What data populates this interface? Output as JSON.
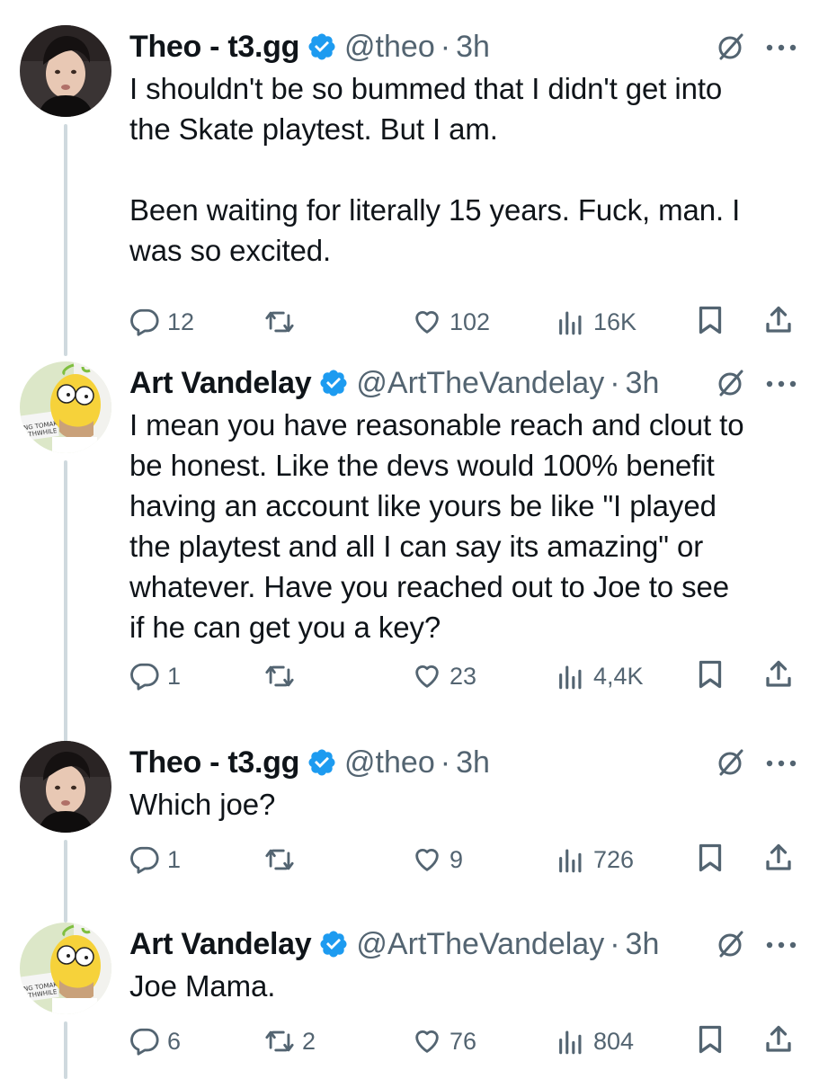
{
  "tweets": [
    {
      "author": "Theo - t3.gg",
      "handle": "@theo",
      "separator": "·",
      "time": "3h",
      "avatar": "theo-avatar",
      "text": "I shouldn't be so bummed that I didn't get into\nthe Skate playtest. But I am.\n\nBeen waiting for literally 15 years. Fuck, man. I\nwas so excited.",
      "replies": "12",
      "reposts": "",
      "likes": "102",
      "views": "16K"
    },
    {
      "author": "Art Vandelay",
      "handle": "@ArtTheVandelay",
      "separator": "·",
      "time": "3h",
      "avatar": "homer-avatar",
      "text": "I mean you have reasonable reach and clout to\nbe honest. Like the devs would 100% benefit\nhaving an account like yours be like \"I played\nthe playtest and all I can say its amazing\" or\nwhatever. Have you reached out to Joe to see\nif he can get you a key?",
      "replies": "1",
      "reposts": "",
      "likes": "23",
      "views": "4,4K"
    },
    {
      "author": "Theo - t3.gg",
      "handle": "@theo",
      "separator": "·",
      "time": "3h",
      "avatar": "theo-avatar",
      "text": "Which joe?",
      "replies": "1",
      "reposts": "",
      "likes": "9",
      "views": "726"
    },
    {
      "author": "Art Vandelay",
      "handle": "@ArtTheVandelay",
      "separator": "·",
      "time": "3h",
      "avatar": "homer-avatar",
      "text": "Joe Mama.",
      "replies": "6",
      "reposts": "2",
      "likes": "76",
      "views": "804"
    }
  ],
  "colors": {
    "verified": "#1d9bf0",
    "secondary_text": "#536471",
    "thread_line": "#cfd9de",
    "primary_text": "#0f1419"
  },
  "icons": [
    "verified-badge-icon",
    "grok-icon",
    "more-icon",
    "reply-icon",
    "repost-icon",
    "like-icon",
    "views-icon",
    "bookmark-icon",
    "share-icon"
  ]
}
